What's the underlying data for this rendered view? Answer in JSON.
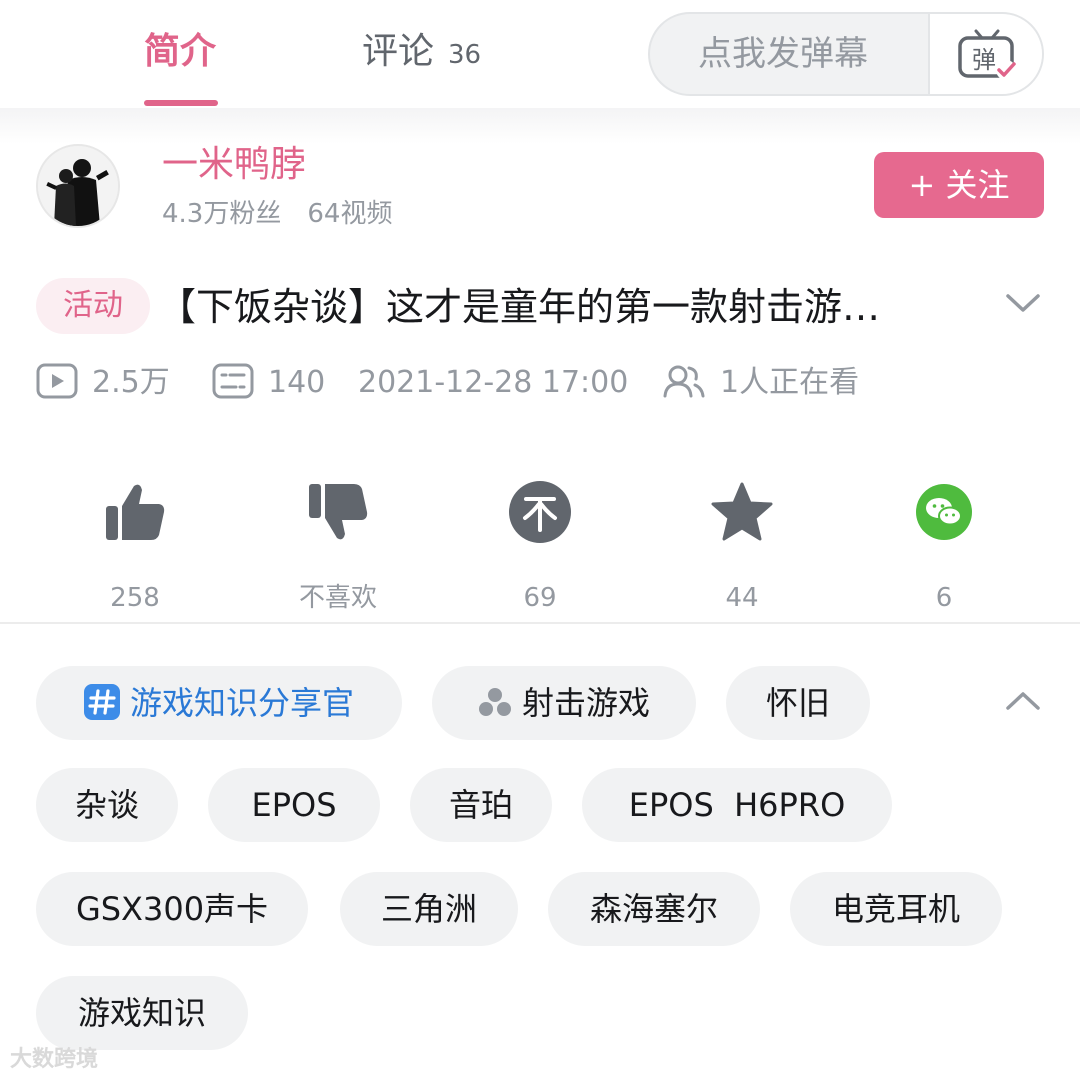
{
  "tabs": {
    "intro": "简介",
    "comments": "评论",
    "comments_count": "36"
  },
  "danmaku": {
    "placeholder": "点我发弹幕",
    "button": "弹"
  },
  "uploader": {
    "name": "一米鸭脖",
    "fans": "4.3万粉丝",
    "videos": "64视频",
    "follow": "+ 关注"
  },
  "video": {
    "badge": "活动",
    "title": "【下饭杂谈】这才是童年的第一款射击游…",
    "views": "2.5万",
    "danmaku_count": "140",
    "date": "2021-12-28 17:00",
    "watching": "1人正在看"
  },
  "actions": {
    "like": "258",
    "dislike": "不喜欢",
    "coin": "69",
    "favorite": "44",
    "share": "6"
  },
  "tags": [
    "游戏知识分享官",
    "射击游戏",
    "怀旧",
    "杂谈",
    "EPOS",
    "音珀",
    "EPOS  H6PRO",
    "GSX300声卡",
    "三角洲",
    "森海塞尔",
    "电竞耳机",
    "游戏知识"
  ],
  "watermark": "大数跨境",
  "colors": {
    "brand_pink": "#e0648a",
    "follow_bg": "#e6698f",
    "tag_bg": "#f1f2f3",
    "topic_blue": "#2a79d6",
    "wechat_green": "#4fbb3e"
  },
  "icons": [
    "danmaku-send-icon",
    "chevron-down-icon",
    "play-count-icon",
    "danmaku-count-icon",
    "watching-icon",
    "thumbs-up-icon",
    "thumbs-down-icon",
    "coin-icon",
    "star-icon",
    "wechat-icon",
    "hashtag-icon",
    "category-icon",
    "chevron-up-icon"
  ]
}
